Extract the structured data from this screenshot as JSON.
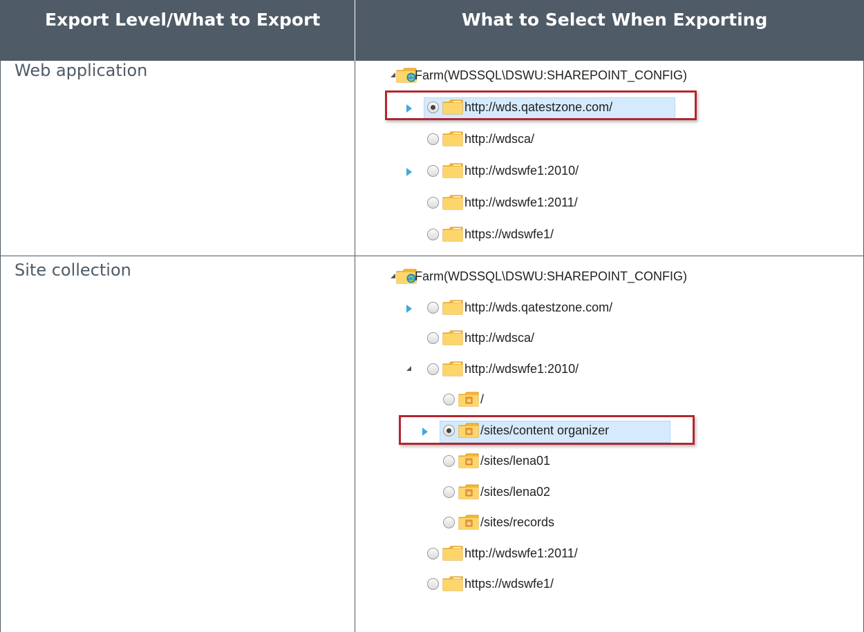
{
  "header": {
    "col1": "Export Level/What to Export",
    "col2": "What to Select When Exporting"
  },
  "rows": [
    {
      "label": "Web application",
      "tree": [
        {
          "text": "Farm(WDSSQL\\DSWU:SHAREPOINT_CONFIG)",
          "icon": "farm-icon",
          "toggle": "expanded",
          "radio": false,
          "checked": false,
          "selected": false
        },
        {
          "text": "http://wds.qatestzone.com/",
          "icon": "folder-icon",
          "toggle": "collapsed",
          "radio": true,
          "checked": true,
          "selected": true
        },
        {
          "text": "http://wdsca/",
          "icon": "folder-icon",
          "toggle": "none",
          "radio": true,
          "checked": false,
          "selected": false
        },
        {
          "text": "http://wdswfe1:2010/",
          "icon": "folder-icon",
          "toggle": "collapsed",
          "radio": true,
          "checked": false,
          "selected": false
        },
        {
          "text": "http://wdswfe1:2011/",
          "icon": "folder-icon",
          "toggle": "none",
          "radio": true,
          "checked": false,
          "selected": false
        },
        {
          "text": "https://wdswfe1/",
          "icon": "folder-icon",
          "toggle": "none",
          "radio": true,
          "checked": false,
          "selected": false
        }
      ]
    },
    {
      "label": "Site collection",
      "tree": [
        {
          "text": "Farm(WDSSQL\\DSWU:SHAREPOINT_CONFIG)",
          "icon": "farm-icon",
          "toggle": "expanded",
          "radio": false,
          "checked": false,
          "selected": false
        },
        {
          "text": "http://wds.qatestzone.com/",
          "icon": "folder-icon",
          "toggle": "collapsed",
          "radio": true,
          "checked": false,
          "selected": false
        },
        {
          "text": "http://wdsca/",
          "icon": "folder-icon",
          "toggle": "none",
          "radio": true,
          "checked": false,
          "selected": false
        },
        {
          "text": "http://wdswfe1:2010/",
          "icon": "folder-icon",
          "toggle": "expanded",
          "radio": true,
          "checked": false,
          "selected": false
        },
        {
          "text": "/",
          "icon": "site-folder-icon",
          "toggle": "none",
          "radio": true,
          "checked": false,
          "selected": false
        },
        {
          "text": "/sites/content organizer",
          "icon": "site-folder-icon",
          "toggle": "collapsed",
          "radio": true,
          "checked": true,
          "selected": true
        },
        {
          "text": "/sites/lena01",
          "icon": "site-folder-icon",
          "toggle": "none",
          "radio": true,
          "checked": false,
          "selected": false
        },
        {
          "text": "/sites/lena02",
          "icon": "site-folder-icon",
          "toggle": "none",
          "radio": true,
          "checked": false,
          "selected": false
        },
        {
          "text": "/sites/records",
          "icon": "site-folder-icon",
          "toggle": "none",
          "radio": true,
          "checked": false,
          "selected": false
        },
        {
          "text": "http://wdswfe1:2011/",
          "icon": "folder-icon",
          "toggle": "none",
          "radio": true,
          "checked": false,
          "selected": false
        },
        {
          "text": "https://wdswfe1/",
          "icon": "folder-icon",
          "toggle": "none",
          "radio": true,
          "checked": false,
          "selected": false
        }
      ]
    }
  ],
  "colors": {
    "header_bg": "#4f5b66",
    "highlight_border": "#b3262f",
    "selection_bg": "#d5eafc",
    "expand_arrow": "#3fa9e0"
  }
}
